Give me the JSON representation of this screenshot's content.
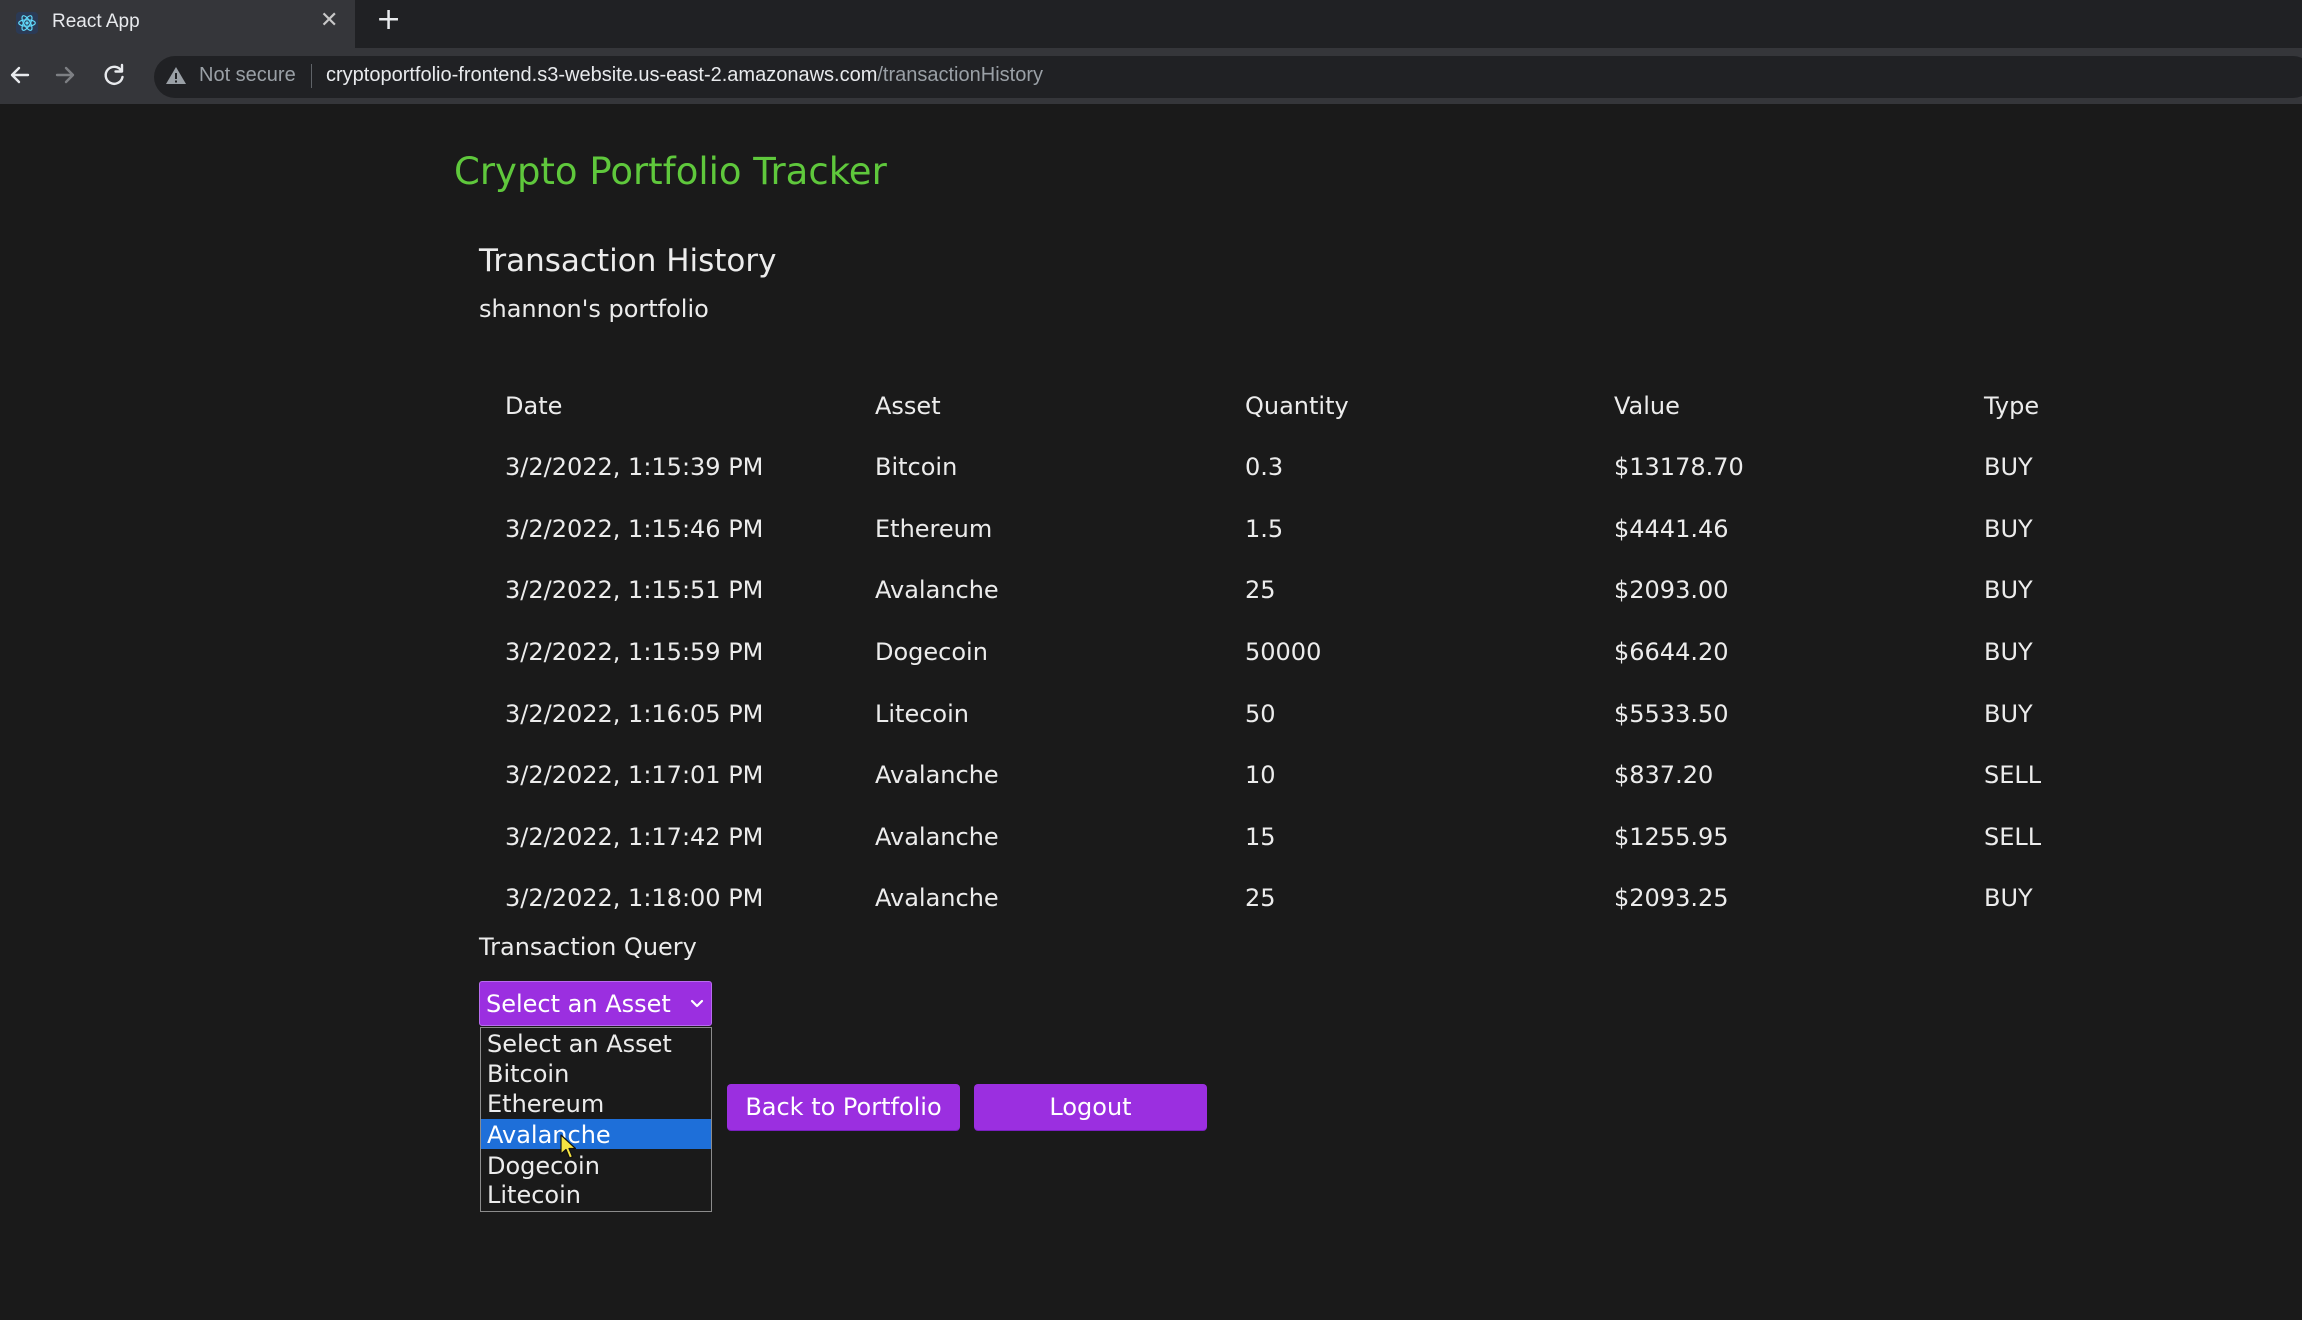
{
  "browser": {
    "tab_title": "React App",
    "close_glyph": "✕",
    "new_tab_glyph": "+",
    "security_label": "Not secure",
    "url_host": "cryptoportfolio-frontend.s3-website.us-east-2.amazonaws.com",
    "url_path": "/transactionHistory",
    "icons": [
      "react-favicon-icon",
      "back-icon",
      "forward-icon",
      "reload-icon",
      "warning-icon"
    ]
  },
  "app": {
    "title": "Crypto Portfolio Tracker",
    "section_title": "Transaction History",
    "portfolio_label": "shannon's portfolio"
  },
  "table": {
    "headers": [
      "Date",
      "Asset",
      "Quantity",
      "Value",
      "Type"
    ],
    "rows": [
      [
        "3/2/2022, 1:15:39 PM",
        "Bitcoin",
        "0.3",
        "$13178.70",
        "BUY"
      ],
      [
        "3/2/2022, 1:15:46 PM",
        "Ethereum",
        "1.5",
        "$4441.46",
        "BUY"
      ],
      [
        "3/2/2022, 1:15:51 PM",
        "Avalanche",
        "25",
        "$2093.00",
        "BUY"
      ],
      [
        "3/2/2022, 1:15:59 PM",
        "Dogecoin",
        "50000",
        "$6644.20",
        "BUY"
      ],
      [
        "3/2/2022, 1:16:05 PM",
        "Litecoin",
        "50",
        "$5533.50",
        "BUY"
      ],
      [
        "3/2/2022, 1:17:01 PM",
        "Avalanche",
        "10",
        "$837.20",
        "SELL"
      ],
      [
        "3/2/2022, 1:17:42 PM",
        "Avalanche",
        "15",
        "$1255.95",
        "SELL"
      ],
      [
        "3/2/2022, 1:18:00 PM",
        "Avalanche",
        "25",
        "$2093.25",
        "BUY"
      ]
    ]
  },
  "query": {
    "label": "Transaction Query",
    "select_value": "Select an Asset",
    "options": [
      "Select an Asset",
      "Bitcoin",
      "Ethereum",
      "Avalanche",
      "Dogecoin",
      "Litecoin"
    ],
    "highlighted_option": "Avalanche"
  },
  "buttons": {
    "back_label": "Back to Portfolio",
    "logout_label": "Logout"
  },
  "colors": {
    "page_bg": "#1a1a1a",
    "title_green": "#5fc83c",
    "accent_purple": "#9b2fe0",
    "option_highlight": "#1e6fd9"
  }
}
